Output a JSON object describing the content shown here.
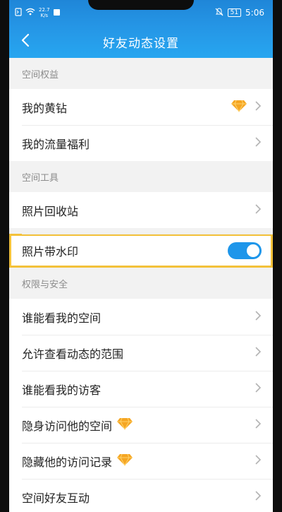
{
  "status_bar": {
    "speed_value": "22.7",
    "speed_unit": "K/s",
    "battery": "51",
    "time": "5:06"
  },
  "header": {
    "title": "好友动态设置"
  },
  "sections": [
    {
      "title": "空间权益",
      "items": [
        {
          "label": "我的黄钻",
          "badge": "diamond-icon"
        },
        {
          "label": "我的流量福利"
        }
      ]
    },
    {
      "title": "空间工具",
      "items": [
        {
          "label": "照片回收站"
        },
        {
          "label": "照片带水印",
          "toggle": true
        }
      ]
    },
    {
      "title": "权限与安全",
      "items": [
        {
          "label": "谁能看我的空间"
        },
        {
          "label": "允许查看动态的范围"
        },
        {
          "label": "谁能看我的访客"
        },
        {
          "label": "隐身访问他的空间",
          "badge": "diamond-icon"
        },
        {
          "label": "隐藏他的访问记录",
          "badge": "diamond-icon"
        },
        {
          "label": "空间好友互动"
        }
      ]
    }
  ],
  "colors": {
    "accent_blue": "#2595e5",
    "highlight_yellow": "#f3c13a",
    "diamond_orange": "#f5a623"
  }
}
